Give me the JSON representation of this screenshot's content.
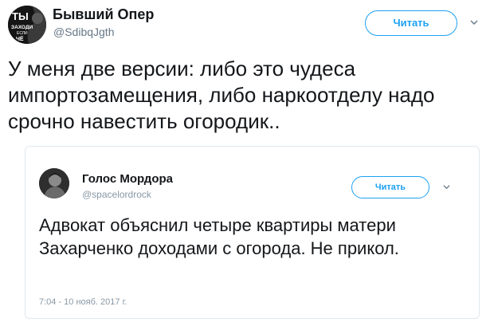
{
  "tweet": {
    "author_name": "Бывший Опер",
    "author_handle": "@SdibqJgth",
    "avatar_text": [
      "ТЫ",
      "ЗАХОДИ",
      "ЕСЛИ",
      "ЧЁ"
    ],
    "follow_label": "Читать",
    "menu_icon": "chevron-down-icon",
    "text": "У меня две версии: либо это чудеса импортозамещения, либо наркоотделу надо срочно навестить огородик.."
  },
  "quoted_tweet": {
    "author_name": "Голос Мордора",
    "author_handle": "@spacelordrock",
    "follow_label": "Читать",
    "menu_icon": "chevron-down-icon",
    "text": "Адвокат объяснил четыре квартиры матери Захарченко доходами с огорода. Не прикол.",
    "timestamp": "7:04 - 10 нояб. 2017 г."
  },
  "colors": {
    "accent": "#1da1f2",
    "text": "#14171a",
    "muted": "#657786",
    "border": "#e1e8ed"
  }
}
